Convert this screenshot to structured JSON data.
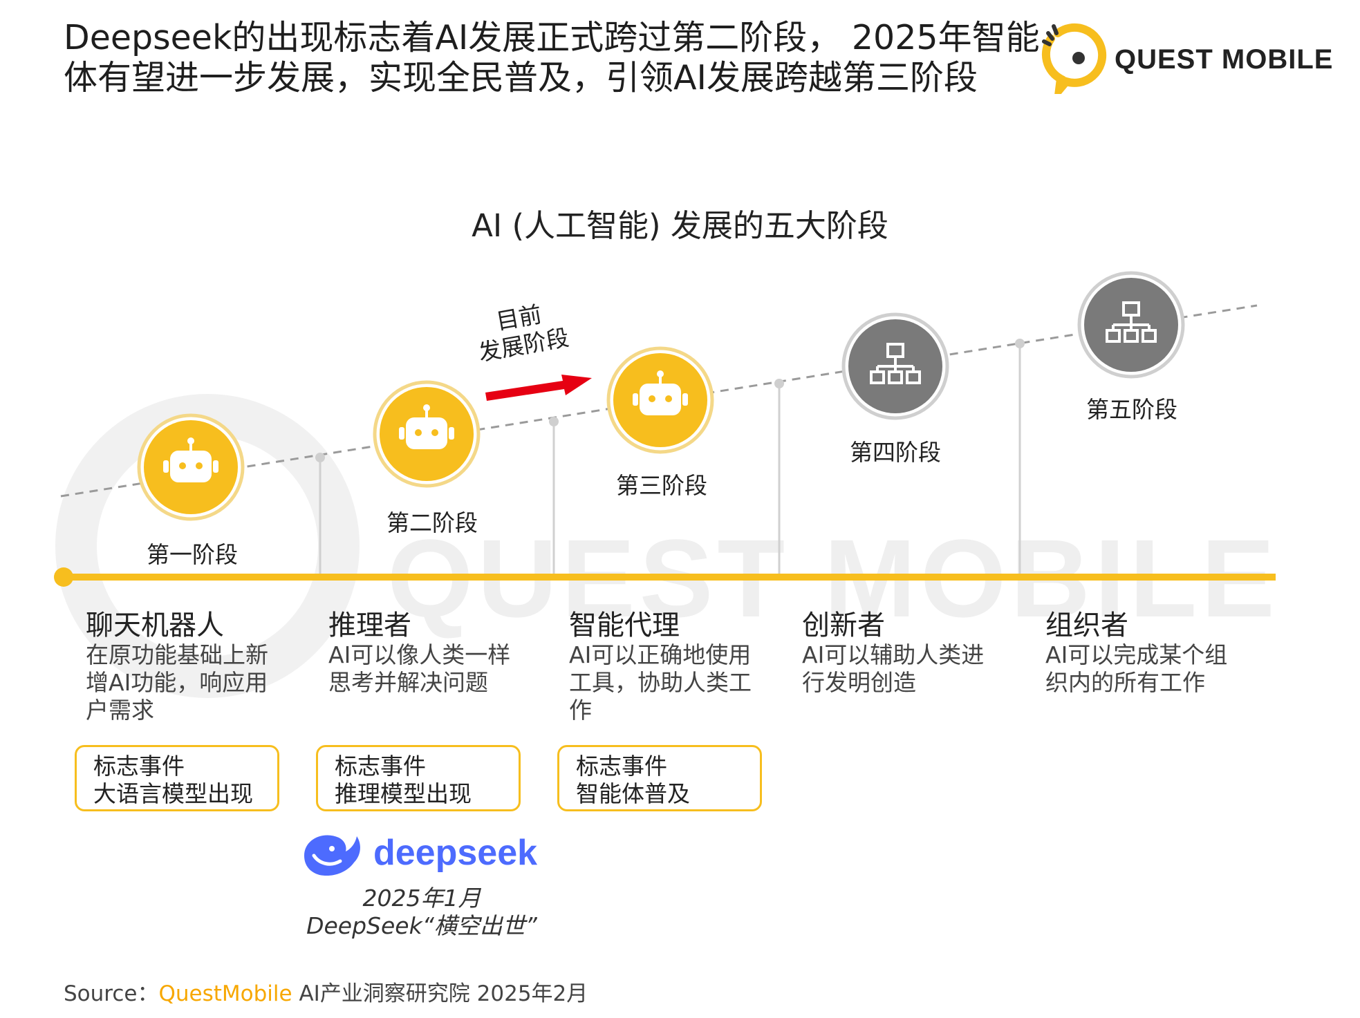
{
  "headline": {
    "line1": "Deepseek的出现标志着AI发展正式跨过第二阶段， 2025年智能",
    "line2": "体有望进一步发展，实现全民普及，引领AI发展跨越第三阶段"
  },
  "brand": {
    "name": "QUEST MOBILE",
    "logo_icon": "quest-mobile-logo-icon",
    "color": "#F7BE1E"
  },
  "watermark": "QUEST MOBILE",
  "diagram_title": "AI (人工智能) 发展的五大阶段",
  "current_marker": {
    "line1": "目前",
    "line2": "发展阶段",
    "arrow_color": "#E60012"
  },
  "colors": {
    "active": "#F7BE1E",
    "inactive": "#7A7A7A",
    "timeline": "#F7BE1E"
  },
  "stages": [
    {
      "label": "第一阶段",
      "name": "聊天机器人",
      "desc": "在原功能基础上新增AI功能，响应用户需求",
      "icon": "robot-icon",
      "active": true,
      "event": {
        "title": "标志事件",
        "text": "大语言模型出现"
      }
    },
    {
      "label": "第二阶段",
      "name": "推理者",
      "desc": "AI可以像人类一样思考并解决问题",
      "icon": "robot-icon",
      "active": true,
      "event": {
        "title": "标志事件",
        "text": "推理模型出现"
      }
    },
    {
      "label": "第三阶段",
      "name": "智能代理",
      "desc": "AI可以正确地使用工具，协助人类工作",
      "icon": "robot-icon",
      "active": true,
      "event": {
        "title": "标志事件",
        "text": "智能体普及"
      }
    },
    {
      "label": "第四阶段",
      "name": "创新者",
      "desc": "AI可以辅助人类进行发明创造",
      "icon": "org-chart-icon",
      "active": false
    },
    {
      "label": "第五阶段",
      "name": "组织者",
      "desc": "AI可以完成某个组织内的所有工作",
      "icon": "org-chart-icon",
      "active": false
    }
  ],
  "deepseek": {
    "wordmark": "deepseek",
    "date": "2025年1月",
    "caption": "DeepSeek“横空出世”",
    "color": "#4D6BFE"
  },
  "source": {
    "prefix": "Source：",
    "brand": "QuestMobile",
    "rest": " AI产业洞察研究院 2025年2月"
  }
}
